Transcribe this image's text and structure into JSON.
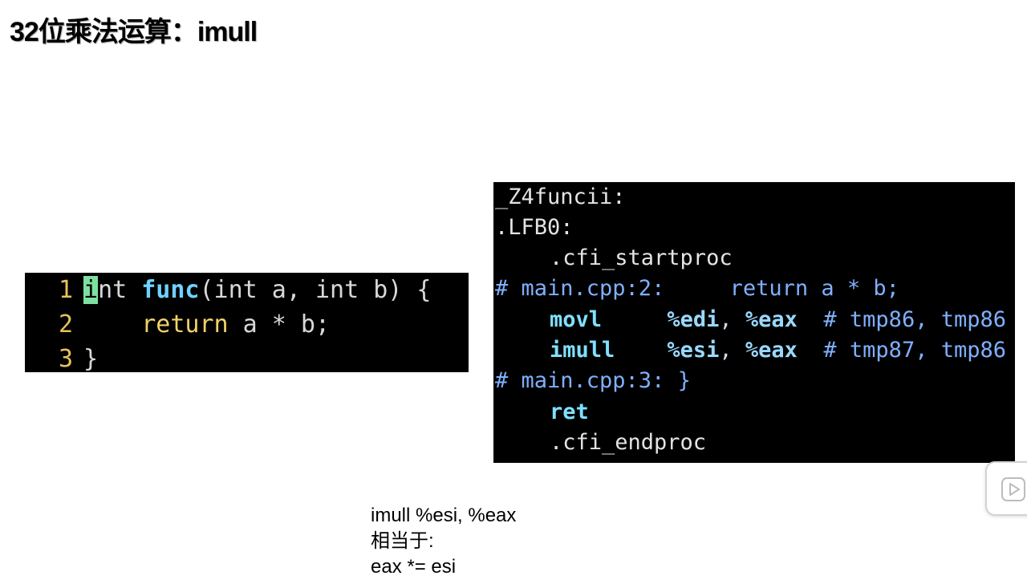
{
  "slide": {
    "title": "32位乘法运算：imull"
  },
  "cpp_code": {
    "lines": [
      {
        "num": "1",
        "cursor_char": "i",
        "rest_int": "nt ",
        "func": "func",
        "sig": "(int a, int b) {"
      },
      {
        "num": "2",
        "indent": "    ",
        "ret": "return",
        "expr": " a * b;"
      },
      {
        "num": "3",
        "text": "}"
      }
    ]
  },
  "asm_code": {
    "label1": "_Z4funcii:",
    "label2": ".LFB0:",
    "startproc": ".cfi_startproc",
    "comment1": "# main.cpp:2:     return a * b;",
    "movl": {
      "mnem": "movl",
      "src": "%edi",
      "sep": ", ",
      "dst": "%eax",
      "comment": "# tmp86, tmp86"
    },
    "imull": {
      "mnem": "imull",
      "src": "%esi",
      "sep": ", ",
      "dst": "%eax",
      "comment": "# tmp87, tmp86"
    },
    "comment2": "# main.cpp:3: }",
    "ret": "ret",
    "endproc": ".cfi_endproc"
  },
  "explanation": {
    "line1": "imull %esi, %eax",
    "line2": "相当于:",
    "line3": "eax *= esi"
  },
  "icons": {
    "play": "play-icon"
  }
}
